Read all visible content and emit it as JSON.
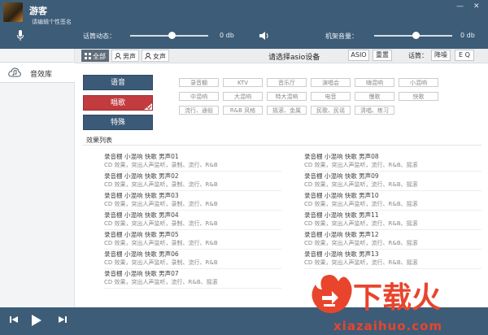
{
  "header": {
    "username": "游客",
    "signature": "请编辑个性签名",
    "window_buttons": [
      "—",
      "✕"
    ],
    "controls": {
      "mic_label": "话筒动态：",
      "mic_level": 0.54,
      "mic_value": "0 db",
      "machine_label": "机架音量：",
      "machine_level": 0.54,
      "machine_value": "0 db"
    }
  },
  "sidebar": {
    "items": [
      {
        "label": "音效库",
        "icon": "cloud-music-icon"
      }
    ]
  },
  "toolbar": {
    "filters": [
      {
        "label": "全部",
        "selected": true
      },
      {
        "label": "男声"
      },
      {
        "label": "女声"
      }
    ],
    "title": "请选择asio设备",
    "asio_label": "ASIO",
    "reset_label": "重置",
    "mic_label": "话筒：",
    "noise_label": "降噪",
    "eq_label": "E Q"
  },
  "categories": [
    {
      "label": "语音"
    },
    {
      "label": "唱歌",
      "selected": true
    },
    {
      "label": "特殊"
    }
  ],
  "effect_tags": [
    [
      "录音棚",
      "KTV",
      "音乐厅",
      "演唱会",
      "嗨混响",
      "小混响"
    ],
    [
      "中混响",
      "大混响",
      "特大混响",
      "电音",
      "慢歌",
      "快歌"
    ],
    [
      "流行、通俗",
      "R&B 风格",
      "摇滚、金属",
      "民歌、民谣",
      "清唱、练习"
    ]
  ],
  "effects_list": {
    "title": "效果列表",
    "left": [
      {
        "name": "录音棚 小混响 快歌 男声01",
        "desc": "CD 效果，突出人声监听，录制、流行、R&B"
      },
      {
        "name": "录音棚 小混响 快歌 男声02",
        "desc": "CD 效果，突出人声监听，录制、流行、R&B"
      },
      {
        "name": "录音棚 小混响 快歌 男声03",
        "desc": "CD 效果，突出人声监听，录制、流行、R&B"
      },
      {
        "name": "录音棚 小混响 快歌 男声04",
        "desc": "CD 效果，突出人声监听，录制、流行、R&B"
      },
      {
        "name": "录音棚 小混响 快歌 男声05",
        "desc": "CD 效果，突出人声监听，录制、流行、R&B"
      },
      {
        "name": "录音棚 小混响 快歌 男声06",
        "desc": "CD 效果，突出人声监听，录制、流行、R&B"
      },
      {
        "name": "录音棚 小混响 快歌 男声07",
        "desc": "CD 效果，突出人声监听，流行、R&B、摇滚"
      }
    ],
    "right": [
      {
        "name": "录音棚 小混响 快歌 男声08",
        "desc": "CD 效果，突出人声监听，流行、R&B、摇滚"
      },
      {
        "name": "录音棚 小混响 快歌 男声09",
        "desc": "CD 效果，突出人声监听，流行、R&B、摇滚"
      },
      {
        "name": "录音棚 小混响 快歌 男声10",
        "desc": "CD 效果，突出人声监听，流行、R&B、摇滚"
      },
      {
        "name": "录音棚 小混响 快歌 男声11",
        "desc": "CD 效果，突出人声监听，流行、R&B、摇滚"
      },
      {
        "name": "录音棚 小混响 快歌 男声12",
        "desc": "CD 效果，突出人声监听，流行、R&B、摇滚"
      },
      {
        "name": "录音棚 小混响 快歌 男声13",
        "desc": "CD 效果，突出人声监听，流行、R&B、摇滚"
      }
    ]
  },
  "watermark": {
    "text": "下载火",
    "url": "xiazaihuo.com"
  },
  "colors": {
    "header": "#3d5c78",
    "category": "#3b5a78",
    "category_selected": "#c23b3e",
    "watermark": "#e8452c"
  }
}
